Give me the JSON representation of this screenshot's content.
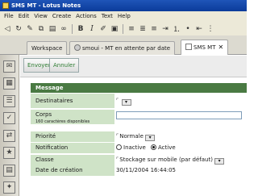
{
  "window": {
    "title": "SMS MT - Lotus Notes"
  },
  "menu": [
    "File",
    "Edit",
    "View",
    "Create",
    "Actions",
    "Text",
    "Help"
  ],
  "toolbar": {
    "icons": [
      "back-icon",
      "refresh-icon",
      "edit-icon",
      "copy-icon",
      "paste-icon",
      "link-icon",
      "bold-icon",
      "italic-icon",
      "align-icon",
      "bullet-icon",
      "indent-icon"
    ],
    "bold_glyph": "B",
    "italic_glyph": "I"
  },
  "tabs": [
    {
      "label": "Workspace"
    },
    {
      "label": "smoui - MT en attente par date"
    },
    {
      "label": "SMS MT"
    }
  ],
  "actions": {
    "send": "Envoyer",
    "cancel": "Annuler"
  },
  "form": {
    "section_title": "Message",
    "fields": {
      "recipients": {
        "label": "Destinataires",
        "value": ""
      },
      "body": {
        "label": "Corps",
        "hint": "160 caractères disponibles",
        "value": ""
      },
      "priority": {
        "label": "Priorité",
        "value": "Normale"
      },
      "notification": {
        "label": "Notification",
        "options": [
          "Inactive",
          "Active"
        ],
        "selected": "Active"
      },
      "class": {
        "label": "Classe",
        "value": "Stockage sur mobile (par défaut)"
      },
      "created": {
        "label": "Date de création",
        "value": "30/11/2004 16:44:05"
      }
    }
  }
}
